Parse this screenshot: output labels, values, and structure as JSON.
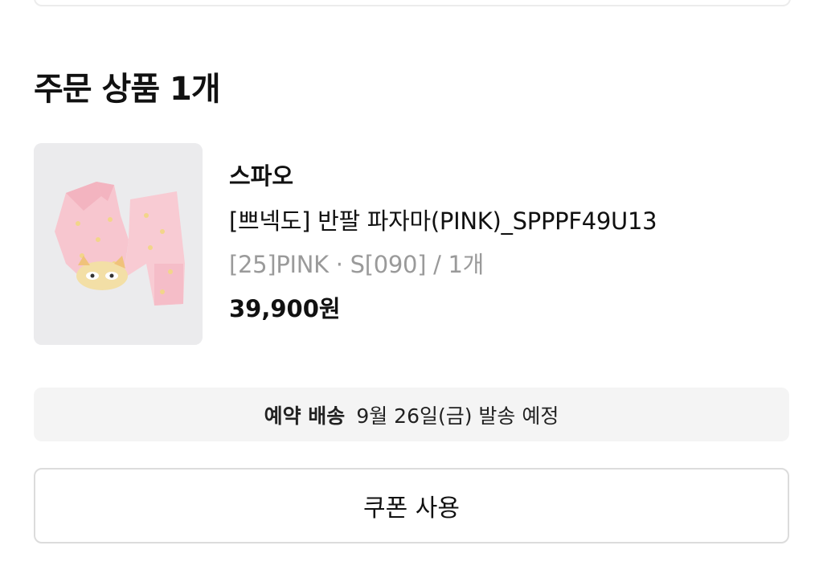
{
  "order_section": {
    "title": "주문 상품 1개"
  },
  "product": {
    "brand": "스파오",
    "name": "[쁘넥도] 반팔 파자마(PINK)_SPPPF49U13",
    "option": "[25]PINK · S[090] / 1개",
    "price": "39,900원",
    "image_icon": "pink-pajama-set-photo"
  },
  "shipping": {
    "label": "예약 배송",
    "detail": "9월 26일(금) 발송 예정"
  },
  "coupon": {
    "label": "쿠폰 사용"
  },
  "colors": {
    "text_primary": "#111111",
    "text_secondary": "#9a9a9a",
    "banner_bg": "#f4f4f4",
    "border": "#dcdcdc"
  }
}
